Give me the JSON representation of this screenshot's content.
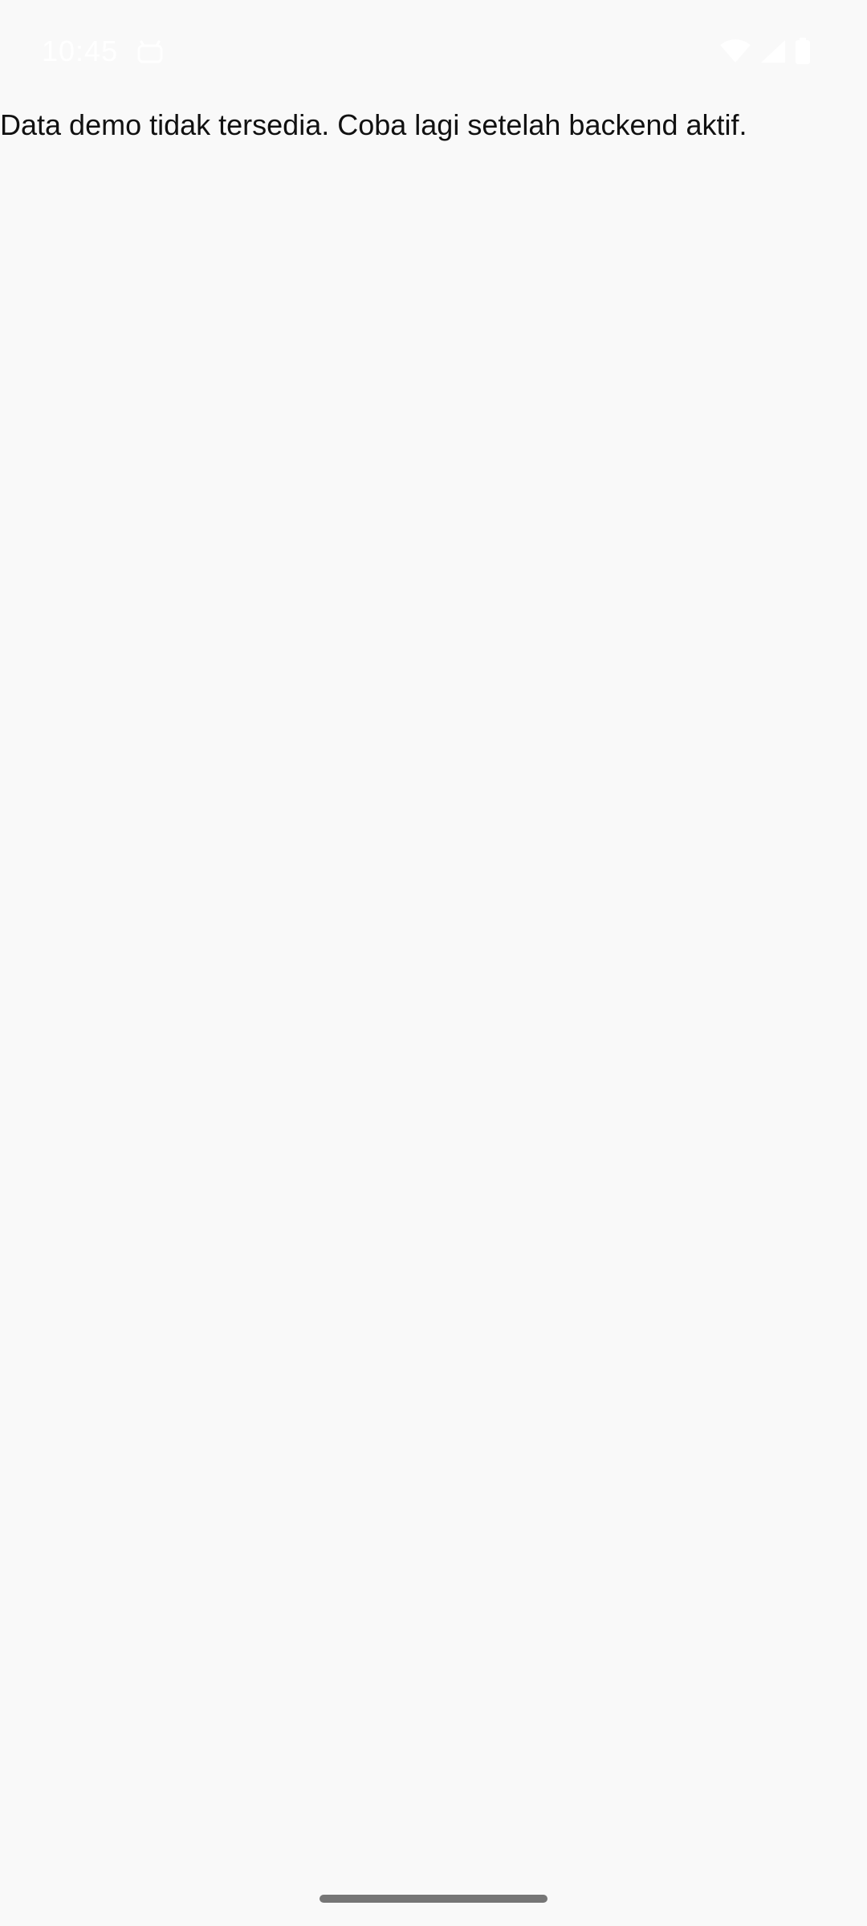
{
  "status_bar": {
    "time": "10:45",
    "app_notification_icon": "android-debug-icon",
    "wifi_icon": "wifi-icon",
    "signal_icon": "cell-signal-icon",
    "battery_icon": "battery-icon",
    "icon_color": "#ffffff"
  },
  "main": {
    "message": "Data demo tidak tersedia. Coba lagi setelah backend aktif."
  },
  "colors": {
    "background": "#f9f9f9",
    "text": "#111111",
    "gesture_handle": "#767676"
  }
}
